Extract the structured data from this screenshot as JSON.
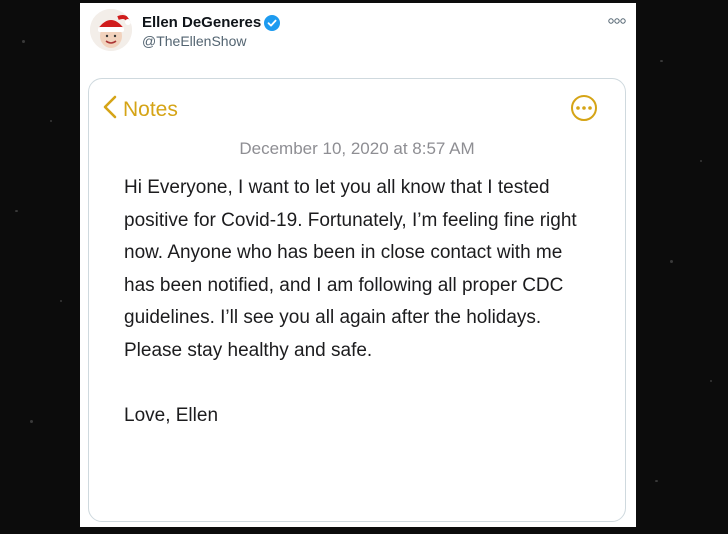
{
  "tweet": {
    "author_name": "Ellen DeGeneres",
    "author_handle": "@TheEllenShow",
    "verified": true,
    "icons": {
      "verified": "verified-badge-icon",
      "more": "more-options-icon"
    }
  },
  "note": {
    "back_label": "Notes",
    "date": "December 10, 2020 at 8:57 AM",
    "body": "Hi Everyone, I want to let you all know that I tested positive for Covid-19. Fortunately, I’m feeling fine right now. Anyone who has been in close contact with me has been notified, and I am following all proper CDC guidelines. I’ll see you all again after the holidays. Please stay healthy and safe.",
    "signoff": "Love, Ellen",
    "icons": {
      "back": "chevron-left-icon",
      "options": "ellipsis-circle-icon"
    }
  },
  "colors": {
    "notes_accent": "#d5a416",
    "verified_blue": "#1d9bf0",
    "date_gray": "#8e8e93",
    "backdrop": "#0c0c0c"
  }
}
